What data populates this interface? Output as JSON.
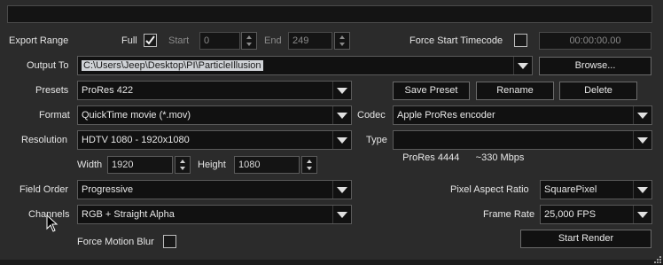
{
  "export_range": {
    "label": "Export Range",
    "full_label": "Full",
    "full_checked": true,
    "start_label": "Start",
    "start_value": "0",
    "end_label": "End",
    "end_value": "249"
  },
  "force_start_timecode": {
    "label": "Force Start Timecode",
    "checked": false,
    "timecode": "00:00:00.00"
  },
  "output_to": {
    "label": "Output To",
    "path": "C:\\Users\\Jeep\\Desktop\\PI\\ParticleIllusion",
    "browse_label": "Browse..."
  },
  "presets": {
    "label": "Presets",
    "value": "ProRes 422",
    "save_label": "Save Preset",
    "rename_label": "Rename",
    "delete_label": "Delete"
  },
  "format": {
    "label": "Format",
    "value": "QuickTime movie (*.mov)"
  },
  "codec": {
    "label": "Codec",
    "value": "Apple ProRes encoder"
  },
  "resolution": {
    "label": "Resolution",
    "value": "HDTV 1080 - 1920x1080"
  },
  "type": {
    "label": "Type",
    "value": "ProRes 4444      ~330 Mbps"
  },
  "size": {
    "width_label": "Width",
    "width_value": "1920",
    "height_label": "Height",
    "height_value": "1080"
  },
  "field_order": {
    "label": "Field Order",
    "value": "Progressive"
  },
  "pixel_aspect": {
    "label": "Pixel Aspect Ratio",
    "value": "SquarePixel"
  },
  "channels": {
    "label": "Channels",
    "value": "RGB + Straight Alpha"
  },
  "frame_rate": {
    "label": "Frame Rate",
    "value": "25,000 FPS"
  },
  "motion_blur": {
    "label": "Force Motion Blur",
    "checked": false
  },
  "render": {
    "label": "Start Render"
  },
  "colors": {
    "background": "#2b2b2b",
    "field": "#111111",
    "border": "#5a5a5a",
    "text": "#e8e8e8"
  }
}
